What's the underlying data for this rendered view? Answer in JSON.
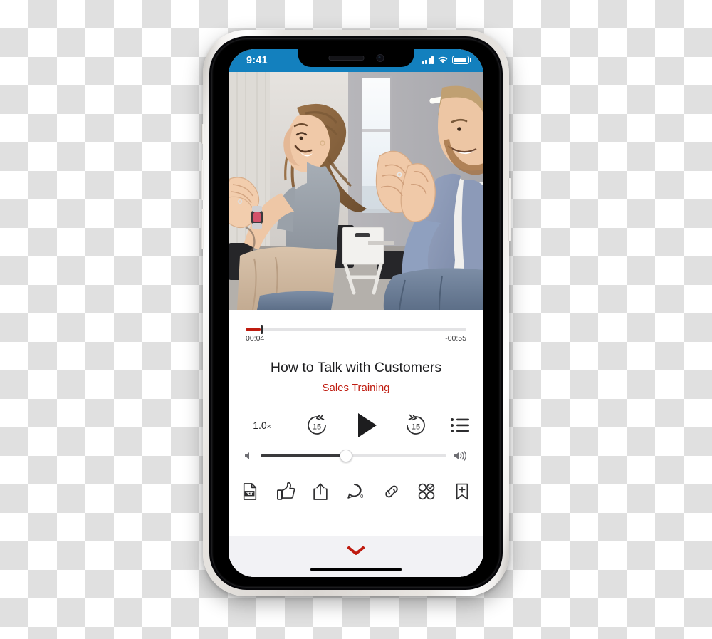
{
  "device": {
    "name": "iphone-x-mockup",
    "frame_color": "#d9d5d1",
    "side_buttons": [
      "silent-switch",
      "volume-up",
      "volume-down",
      "power"
    ]
  },
  "status_bar": {
    "time": "9:41",
    "background": "#1380be",
    "icons": [
      "cellular-signal-icon",
      "wifi-icon",
      "battery-icon"
    ],
    "signal_bars": 4,
    "battery_level_percent": 85
  },
  "video": {
    "alt": "Two people clapping in a training workshop room",
    "is_playing": false
  },
  "player": {
    "progress": {
      "elapsed": "00:04",
      "remaining": "-00:55",
      "percent": 6.8,
      "fill_color": "#bf1b0f"
    },
    "title": "How to Talk with Customers",
    "subtitle": "Sales Training",
    "subtitle_color": "#bf1b0f",
    "controls": {
      "speed_value": "1.0",
      "speed_symbol": "×",
      "rewind_label": "15",
      "forward_label": "15",
      "play_icon": "play-icon",
      "playlist_icon": "playlist-icon"
    },
    "volume": {
      "percent": 46,
      "mute_icon": "speaker-mute-icon",
      "max_icon": "speaker-loud-icon"
    },
    "actions": [
      {
        "name": "pdf-attachment-button",
        "icon": "pdf-icon",
        "label": "PDF"
      },
      {
        "name": "like-button",
        "icon": "thumbs-up-icon",
        "label": ""
      },
      {
        "name": "share-button",
        "icon": "share-icon",
        "label": ""
      },
      {
        "name": "comments-button",
        "icon": "comment-icon",
        "label": "0"
      },
      {
        "name": "link-button",
        "icon": "link-icon",
        "label": ""
      },
      {
        "name": "quiz-button",
        "icon": "quiz-icon",
        "label": ""
      },
      {
        "name": "bookmark-button",
        "icon": "bookmark-add-icon",
        "label": ""
      }
    ]
  },
  "bottom_bar": {
    "collapse_icon": "chevron-down-icon",
    "collapse_color": "#bf1b0f",
    "home_indicator": true
  }
}
